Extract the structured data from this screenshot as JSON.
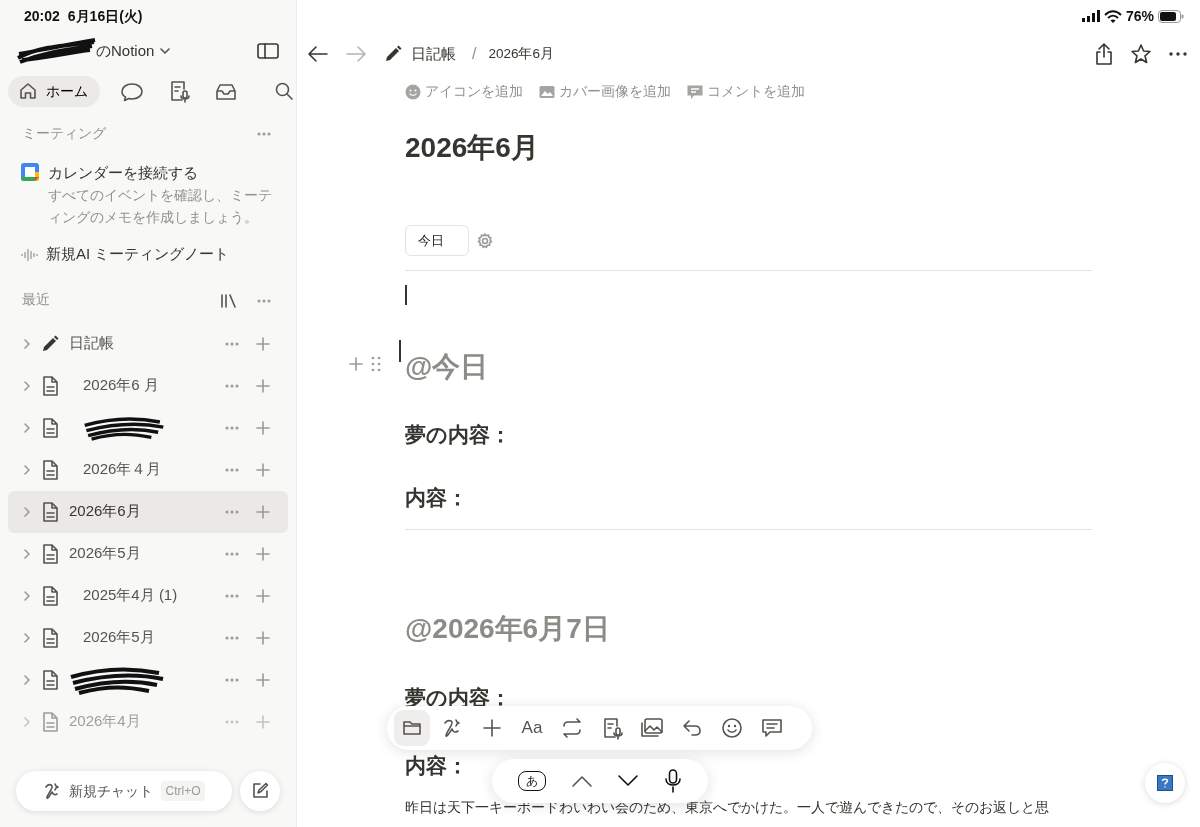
{
  "status_bar": {
    "time": "20:02",
    "date": "6月16日(火)",
    "battery": "76%"
  },
  "sidebar": {
    "workspace": {
      "name": "のNotion",
      "redacted": true
    },
    "nav": [
      {
        "kind": "home",
        "label": "ホーム",
        "selected": true
      },
      {
        "kind": "chat",
        "selected": false
      },
      {
        "kind": "meeting",
        "selected": false
      },
      {
        "kind": "inbox",
        "selected": false
      }
    ],
    "meetings": {
      "header": "ミーティング",
      "calendar_title": "カレンダーを接続する",
      "calendar_description": "すべてのイベントを確認し、ミーティングのメモを作成しましょう。",
      "ai_note": "新規AI ミーティングノート"
    },
    "recent": {
      "header": "最近",
      "items": [
        {
          "kind": "pencil",
          "title": "日記帳",
          "indented": false,
          "redacted": false,
          "selected": false,
          "faded": false
        },
        {
          "kind": "page",
          "title": "2026年6 月",
          "indented": true,
          "redacted": false,
          "selected": false,
          "faded": false
        },
        {
          "kind": "page",
          "indented": true,
          "redacted": true,
          "selected": false,
          "faded": false
        },
        {
          "kind": "page",
          "title": "2026年４月",
          "indented": true,
          "redacted": false,
          "selected": false,
          "faded": false
        },
        {
          "kind": "page",
          "title": "2026年6月",
          "indented": false,
          "redacted": false,
          "selected": true,
          "faded": false
        },
        {
          "kind": "page",
          "title": "2026年5月",
          "indented": false,
          "redacted": false,
          "selected": false,
          "faded": false
        },
        {
          "kind": "page",
          "title": "2025年4月 (1)",
          "indented": true,
          "redacted": false,
          "selected": false,
          "faded": false
        },
        {
          "kind": "page",
          "title": "2026年5月",
          "indented": true,
          "redacted": false,
          "selected": false,
          "faded": false
        },
        {
          "kind": "page",
          "indented": false,
          "redacted": true,
          "selected": false,
          "faded": false
        },
        {
          "kind": "page",
          "title": "2026年4月",
          "indented": false,
          "redacted": false,
          "selected": false,
          "faded": true
        }
      ]
    },
    "new_chat": {
      "label": "新規チャット",
      "shortcut": "Ctrl+O"
    }
  },
  "main": {
    "breadcrumb": [
      {
        "kind": "pencil",
        "label": "日記帳"
      },
      {
        "kind": "separator",
        "label": "/"
      },
      {
        "kind": "page",
        "label": "2026年6月"
      }
    ],
    "page_actions": [
      {
        "kind": "icon",
        "label": "アイコンを追加"
      },
      {
        "kind": "cover",
        "label": "カバー画像を追加"
      },
      {
        "kind": "comment",
        "label": "コメントを追加"
      }
    ],
    "title": "2026年6月",
    "today_button": "今日",
    "blocks": [
      {
        "kind": "divider"
      },
      {
        "kind": "cursor"
      },
      {
        "kind": "heading",
        "text": "@今日",
        "handle": true
      },
      {
        "kind": "label",
        "text": "夢の内容："
      },
      {
        "kind": "label",
        "text": "内容："
      },
      {
        "kind": "divider"
      },
      {
        "kind": "heading",
        "text": "@2026年6月7日",
        "handle": false
      },
      {
        "kind": "label",
        "text": "夢の内容："
      },
      {
        "kind": "label",
        "text": "内容："
      },
      {
        "kind": "paragraph",
        "text": "昨日は天下一キーボードわいわい会のため、東京へでかけた。一人で遊んできたので、そのお返しと思"
      }
    ]
  },
  "toolbar": {
    "items": [
      {
        "kind": "folder",
        "selected": true
      },
      {
        "kind": "ai",
        "selected": false
      },
      {
        "kind": "plus",
        "selected": false
      },
      {
        "kind": "text",
        "label": "Aa",
        "selected": false
      },
      {
        "kind": "swap",
        "selected": false
      },
      {
        "kind": "meeting",
        "selected": false
      },
      {
        "kind": "image",
        "selected": false
      },
      {
        "kind": "undo",
        "selected": false
      },
      {
        "kind": "emoji",
        "selected": false
      },
      {
        "kind": "comment",
        "selected": false
      }
    ]
  },
  "keyboard_bar": {
    "key": "あ"
  }
}
